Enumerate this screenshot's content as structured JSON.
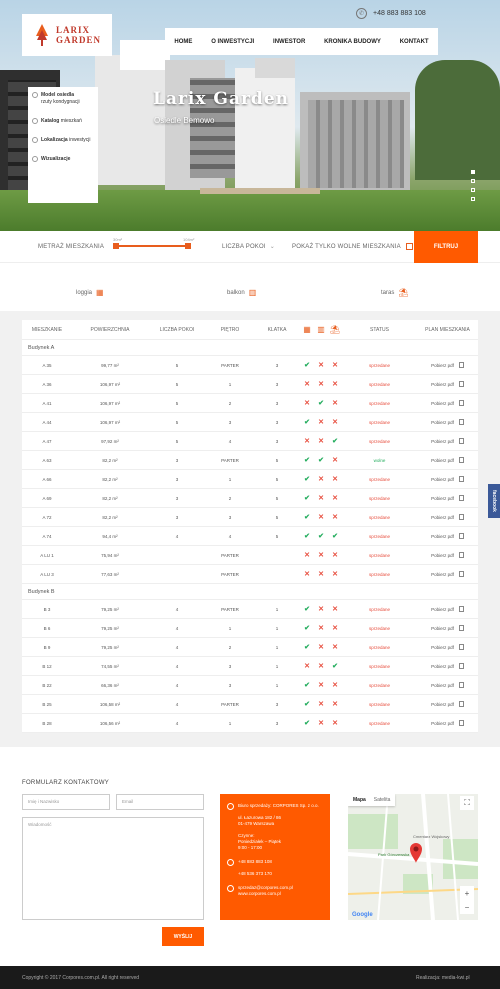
{
  "brand": {
    "line1": "LARIX",
    "line2": "GARDEN"
  },
  "phone": "+48 883 883 108",
  "nav": [
    "HOME",
    "O INWESTYCJI",
    "INWESTOR",
    "KRONIKA BUDOWY",
    "KONTAKT"
  ],
  "side": [
    {
      "strong": "Model osiedla",
      "rest": "rzuty kondygnacji"
    },
    {
      "strong": "Katalog",
      "rest": "mieszkań"
    },
    {
      "strong": "Lokalizacja",
      "rest": "inwestycji"
    },
    {
      "strong": "Wizualizacje",
      "rest": ""
    }
  ],
  "hero": {
    "title": "Larix Garden",
    "subtitle": "Osiedle Bemowo"
  },
  "filter": {
    "area_label": "METRAŻ MIESZKANIA",
    "area_min": "30m²",
    "area_max": "104m²",
    "rooms": "LICZBA POKOI",
    "free_only": "POKAŻ TYLKO WOLNE MIESZKANIA",
    "btn": "FILTRUJ"
  },
  "legend": {
    "loggia": "loggia",
    "balkon": "balkon",
    "taras": "taras"
  },
  "columns": [
    "MIESZKANIE",
    "POWIERZCHNIA",
    "LICZBA POKOI",
    "PIĘTRO",
    "KLATKA",
    "",
    "",
    "",
    "STATUS",
    "PLAN MIESZKANIA"
  ],
  "groups": [
    {
      "name": "Budynek A",
      "rows": [
        {
          "m": "A 35",
          "p": "99,77 m²",
          "r": "5",
          "f": "PARTER",
          "k": "3",
          "l": "y",
          "b": "n",
          "t": "n",
          "s": "sprzedane",
          "plan": "Pobierz pdf"
        },
        {
          "m": "A 36",
          "p": "106,97 m²",
          "r": "5",
          "f": "1",
          "k": "3",
          "l": "n",
          "b": "n",
          "t": "n",
          "s": "sprzedane",
          "plan": "Pobierz pdf"
        },
        {
          "m": "A 41",
          "p": "106,97 m²",
          "r": "5",
          "f": "2",
          "k": "3",
          "l": "n",
          "b": "y",
          "t": "n",
          "s": "sprzedane",
          "plan": "Pobierz pdf"
        },
        {
          "m": "A 44",
          "p": "106,97 m²",
          "r": "5",
          "f": "3",
          "k": "3",
          "l": "y",
          "b": "n",
          "t": "n",
          "s": "sprzedane",
          "plan": "Pobierz pdf"
        },
        {
          "m": "A 47",
          "p": "97,92 m²",
          "r": "5",
          "f": "4",
          "k": "3",
          "l": "n",
          "b": "n",
          "t": "y",
          "s": "sprzedane",
          "plan": "Pobierz pdf"
        },
        {
          "m": "A 63",
          "p": "82,2 m²",
          "r": "3",
          "f": "PARTER",
          "k": "5",
          "l": "y",
          "b": "y",
          "t": "n",
          "s": "wolne",
          "plan": "Pobierz pdf"
        },
        {
          "m": "A 66",
          "p": "82,2 m²",
          "r": "3",
          "f": "1",
          "k": "5",
          "l": "y",
          "b": "n",
          "t": "n",
          "s": "sprzedane",
          "plan": "Pobierz pdf"
        },
        {
          "m": "A 69",
          "p": "82,2 m²",
          "r": "3",
          "f": "2",
          "k": "5",
          "l": "y",
          "b": "n",
          "t": "n",
          "s": "sprzedane",
          "plan": "Pobierz pdf"
        },
        {
          "m": "A 72",
          "p": "82,2 m²",
          "r": "3",
          "f": "3",
          "k": "5",
          "l": "y",
          "b": "n",
          "t": "n",
          "s": "sprzedane",
          "plan": "Pobierz pdf"
        },
        {
          "m": "A 74",
          "p": "94,4 m²",
          "r": "4",
          "f": "4",
          "k": "5",
          "l": "y",
          "b": "y",
          "t": "y",
          "s": "sprzedane",
          "plan": "Pobierz pdf"
        },
        {
          "m": "A LU 1",
          "p": "75,94 m²",
          "r": "",
          "f": "PARTER",
          "k": "",
          "l": "n",
          "b": "n",
          "t": "n",
          "s": "sprzedane",
          "plan": "Pobierz pdf"
        },
        {
          "m": "A LU 3",
          "p": "77,63 m²",
          "r": "",
          "f": "PARTER",
          "k": "",
          "l": "n",
          "b": "n",
          "t": "n",
          "s": "sprzedane",
          "plan": "Pobierz pdf"
        }
      ]
    },
    {
      "name": "Budynek B",
      "rows": [
        {
          "m": "B 3",
          "p": "79,25 m²",
          "r": "4",
          "f": "PARTER",
          "k": "1",
          "l": "y",
          "b": "n",
          "t": "n",
          "s": "sprzedane",
          "plan": "Pobierz pdf"
        },
        {
          "m": "B 6",
          "p": "79,25 m²",
          "r": "4",
          "f": "1",
          "k": "1",
          "l": "y",
          "b": "n",
          "t": "n",
          "s": "sprzedane",
          "plan": "Pobierz pdf"
        },
        {
          "m": "B 9",
          "p": "79,25 m²",
          "r": "4",
          "f": "2",
          "k": "1",
          "l": "y",
          "b": "n",
          "t": "n",
          "s": "sprzedane",
          "plan": "Pobierz pdf"
        },
        {
          "m": "B 12",
          "p": "74,55 m²",
          "r": "4",
          "f": "3",
          "k": "1",
          "l": "n",
          "b": "n",
          "t": "y",
          "s": "sprzedane",
          "plan": "Pobierz pdf"
        },
        {
          "m": "B 22",
          "p": "66,36 m²",
          "r": "4",
          "f": "3",
          "k": "1",
          "l": "y",
          "b": "n",
          "t": "n",
          "s": "sprzedane",
          "plan": "Pobierz pdf"
        },
        {
          "m": "B 25",
          "p": "106,58 m²",
          "r": "4",
          "f": "PARTER",
          "k": "3",
          "l": "y",
          "b": "n",
          "t": "n",
          "s": "sprzedane",
          "plan": "Pobierz pdf"
        },
        {
          "m": "B 28",
          "p": "106,56 m²",
          "r": "4",
          "f": "1",
          "k": "3",
          "l": "y",
          "b": "n",
          "t": "n",
          "s": "sprzedane",
          "plan": "Pobierz pdf"
        }
      ]
    }
  ],
  "contact": {
    "title": "FORMULARZ KONTAKTOWY",
    "name_ph": "Imię i Nazwisko",
    "email_ph": "Email",
    "msg_ph": "Wiadomość",
    "send": "WYŚLIJ",
    "company": "Biuro sprzedaży: CORPORES Sp. z o.o.",
    "addr1": "ul. Łazurowa 182 / 86",
    "addr2": "01-479 Warszawa",
    "hours_t": "Czynne:",
    "hours_d": "Poniedziałek – Piątek",
    "hours_h": "9:00 - 17:00",
    "tel1": "+48 883 883 108",
    "tel2": "+48 536 373 170",
    "mail": "sprzedaz@corpores.com.pl",
    "www": "www.corpores.com.pl"
  },
  "map": {
    "tab1": "Mapa",
    "tab2": "Satelita",
    "place": "Park Górczewska",
    "label": "Cmentarz Wojskowy",
    "logo": "Google"
  },
  "footer": {
    "left": "Copyright © 2017 Corpores.com.pl. All right reserved",
    "right": "Realizacja: media-kwi.pl"
  },
  "facebook": "facebook"
}
